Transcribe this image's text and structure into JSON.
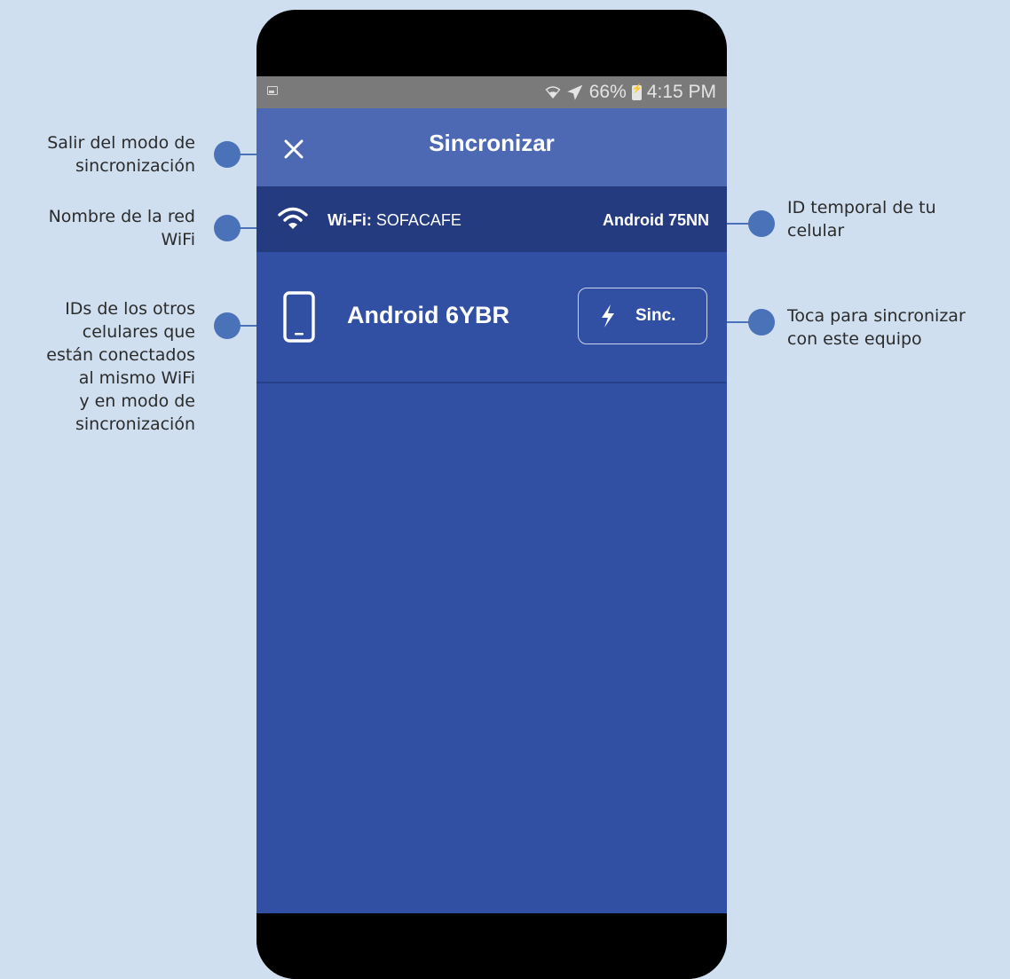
{
  "status_bar": {
    "battery_percent": "66%",
    "time": "4:15 PM"
  },
  "app_bar": {
    "title": "Sincronizar",
    "close_icon": "close-icon"
  },
  "wifi_bar": {
    "label": "Wi-Fi:",
    "network": "SOFACAFE",
    "my_device_id": "Android 75NN"
  },
  "devices": [
    {
      "name": "Android 6YBR",
      "button_label": "Sinc."
    }
  ],
  "callouts": {
    "exit_sync_mode": [
      "Salir del modo de",
      "sincronización"
    ],
    "wifi_name": [
      "Nombre de la red",
      "WiFi"
    ],
    "other_ids": [
      "IDs de los otros",
      "celulares que",
      "están conectados",
      "al mismo WiFi",
      "y en modo de",
      "sincronización"
    ],
    "temp_id": [
      "ID temporal de tu",
      "celular"
    ],
    "tap_to_sync": [
      "Toca para sincronizar",
      "con este equipo"
    ]
  },
  "colors": {
    "background": "#cfdff0",
    "app_bar": "#4d69b3",
    "wifi_bar": "#253b80",
    "content": "#3250a3",
    "callout_dot": "#4a72b8"
  }
}
